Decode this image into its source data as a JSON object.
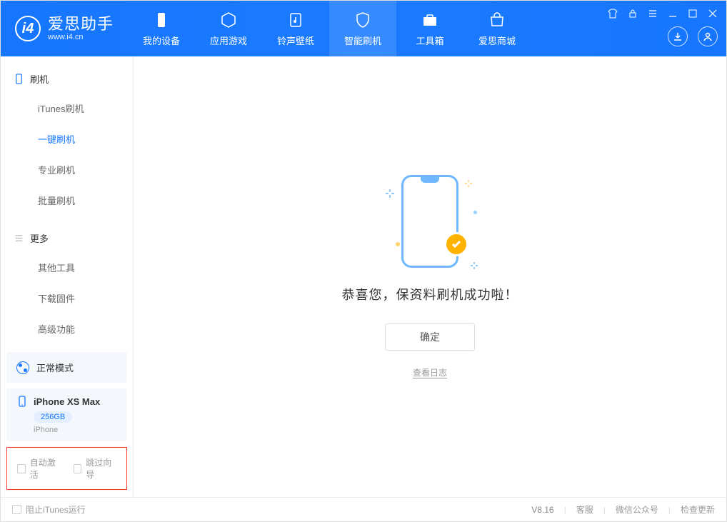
{
  "app": {
    "title": "爱思助手",
    "subtitle": "www.i4.cn"
  },
  "nav_tabs": [
    {
      "label": "我的设备"
    },
    {
      "label": "应用游戏"
    },
    {
      "label": "铃声壁纸"
    },
    {
      "label": "智能刷机"
    },
    {
      "label": "工具箱"
    },
    {
      "label": "爱思商城"
    }
  ],
  "sidebar": {
    "section1": {
      "title": "刷机",
      "items": [
        "iTunes刷机",
        "一键刷机",
        "专业刷机",
        "批量刷机"
      ]
    },
    "section2": {
      "title": "更多",
      "items": [
        "其他工具",
        "下载固件",
        "高级功能"
      ]
    }
  },
  "mode": {
    "label": "正常模式"
  },
  "device": {
    "name": "iPhone XS Max",
    "storage": "256GB",
    "type": "iPhone"
  },
  "options": {
    "auto_activate": "自动激活",
    "skip_guide": "跳过向导"
  },
  "main": {
    "success_msg": "恭喜您，保资料刷机成功啦！",
    "ok_btn": "确定",
    "view_log": "查看日志"
  },
  "statusbar": {
    "block_itunes": "阻止iTunes运行",
    "version": "V8.16",
    "links": [
      "客服",
      "微信公众号",
      "检查更新"
    ]
  }
}
